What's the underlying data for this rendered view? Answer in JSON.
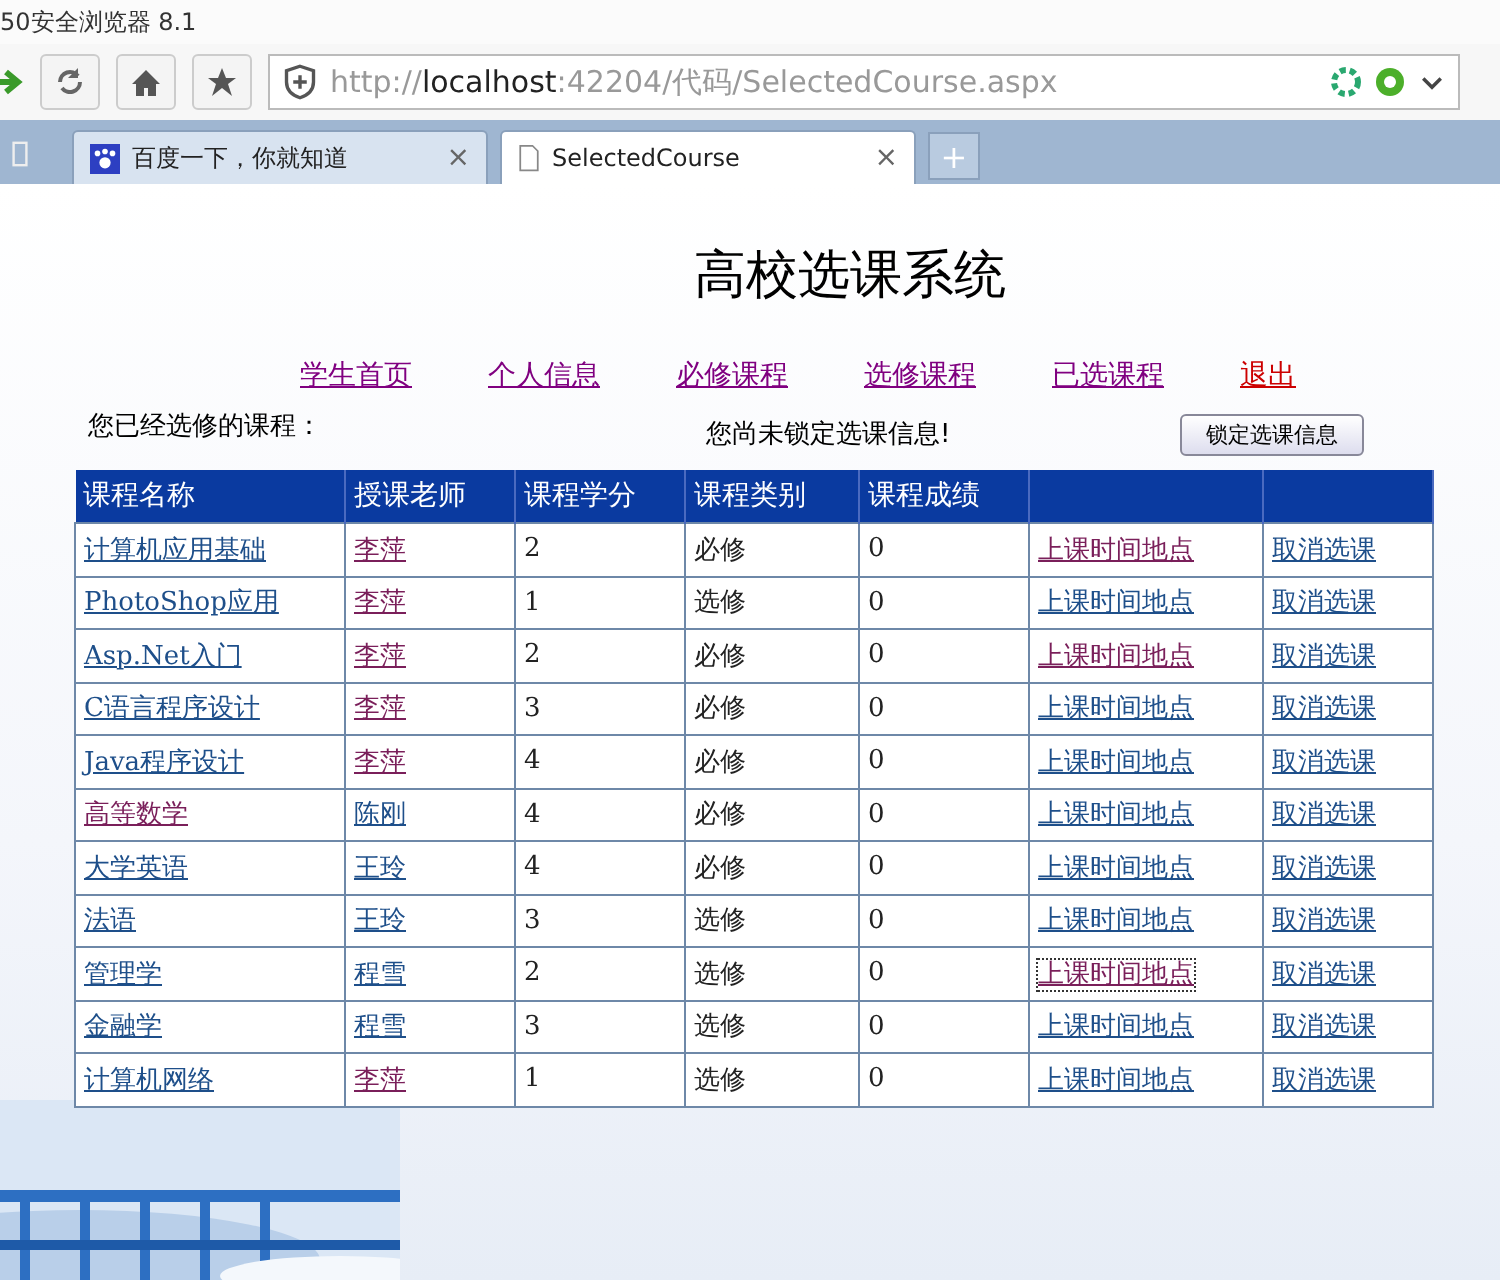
{
  "window": {
    "title": "50安全浏览器 8.1"
  },
  "address_bar": {
    "scheme": "http://",
    "host": "localhost",
    "rest": ":42204/代码/SelectedCourse.aspx"
  },
  "tabs": [
    {
      "label": "百度一下，你就知道",
      "selected": false,
      "close": "×"
    },
    {
      "label": "SelectedCourse",
      "selected": true,
      "close": "×"
    }
  ],
  "new_tab": "+",
  "page": {
    "title": "高校选课系统",
    "nav": [
      {
        "label": "学生首页",
        "color": "#800080"
      },
      {
        "label": "个人信息",
        "color": "#800080"
      },
      {
        "label": "必修课程",
        "color": "#800080"
      },
      {
        "label": "选修课程",
        "color": "#800080"
      },
      {
        "label": "已选课程",
        "color": "#800080"
      },
      {
        "label": "退出",
        "color": "#cc0000"
      }
    ],
    "selected_label": "您已经选修的课程：",
    "lock_status": "您尚未锁定选课信息!",
    "lock_button": "锁定选课信息",
    "table": {
      "columns": [
        "课程名称",
        "授课老师",
        "课程学分",
        "课程类别",
        "课程成绩"
      ],
      "rows": [
        {
          "name": {
            "text": "计算机应用基础",
            "visited": false
          },
          "teacher": {
            "text": "李萍",
            "visited": true
          },
          "credit": "2",
          "type": "必修",
          "score": "0",
          "time": {
            "text": "上课时间地点",
            "visited": true,
            "focused": false
          },
          "cancel": "取消选课"
        },
        {
          "name": {
            "text": "PhotoShop应用",
            "visited": false
          },
          "teacher": {
            "text": "李萍",
            "visited": true
          },
          "credit": "1",
          "type": "选修",
          "score": "0",
          "time": {
            "text": "上课时间地点",
            "visited": false,
            "focused": false
          },
          "cancel": "取消选课"
        },
        {
          "name": {
            "text": "Asp.Net入门",
            "visited": false
          },
          "teacher": {
            "text": "李萍",
            "visited": true
          },
          "credit": "2",
          "type": "必修",
          "score": "0",
          "time": {
            "text": "上课时间地点",
            "visited": true,
            "focused": false
          },
          "cancel": "取消选课"
        },
        {
          "name": {
            "text": "C语言程序设计",
            "visited": false
          },
          "teacher": {
            "text": "李萍",
            "visited": true
          },
          "credit": "3",
          "type": "必修",
          "score": "0",
          "time": {
            "text": "上课时间地点",
            "visited": false,
            "focused": false
          },
          "cancel": "取消选课"
        },
        {
          "name": {
            "text": "Java程序设计",
            "visited": false
          },
          "teacher": {
            "text": "李萍",
            "visited": true
          },
          "credit": "4",
          "type": "必修",
          "score": "0",
          "time": {
            "text": "上课时间地点",
            "visited": false,
            "focused": false
          },
          "cancel": "取消选课"
        },
        {
          "name": {
            "text": "高等数学",
            "visited": true
          },
          "teacher": {
            "text": "陈刚",
            "visited": false
          },
          "credit": "4",
          "type": "必修",
          "score": "0",
          "time": {
            "text": "上课时间地点",
            "visited": false,
            "focused": false
          },
          "cancel": "取消选课"
        },
        {
          "name": {
            "text": "大学英语",
            "visited": false
          },
          "teacher": {
            "text": "王玲",
            "visited": false
          },
          "credit": "4",
          "type": "必修",
          "score": "0",
          "time": {
            "text": "上课时间地点",
            "visited": false,
            "focused": false
          },
          "cancel": "取消选课"
        },
        {
          "name": {
            "text": "法语",
            "visited": false
          },
          "teacher": {
            "text": "王玲",
            "visited": false
          },
          "credit": "3",
          "type": "选修",
          "score": "0",
          "time": {
            "text": "上课时间地点",
            "visited": false,
            "focused": false
          },
          "cancel": "取消选课"
        },
        {
          "name": {
            "text": "管理学",
            "visited": false
          },
          "teacher": {
            "text": "程雪",
            "visited": false
          },
          "credit": "2",
          "type": "选修",
          "score": "0",
          "time": {
            "text": "上课时间地点",
            "visited": true,
            "focused": true
          },
          "cancel": "取消选课"
        },
        {
          "name": {
            "text": "金融学",
            "visited": false
          },
          "teacher": {
            "text": "程雪",
            "visited": false
          },
          "credit": "3",
          "type": "选修",
          "score": "0",
          "time": {
            "text": "上课时间地点",
            "visited": false,
            "focused": false
          },
          "cancel": "取消选课"
        },
        {
          "name": {
            "text": "计算机网络",
            "visited": false
          },
          "teacher": {
            "text": "李萍",
            "visited": true
          },
          "credit": "1",
          "type": "选修",
          "score": "0",
          "time": {
            "text": "上课时间地点",
            "visited": false,
            "focused": false
          },
          "cancel": "取消选课"
        }
      ]
    }
  }
}
